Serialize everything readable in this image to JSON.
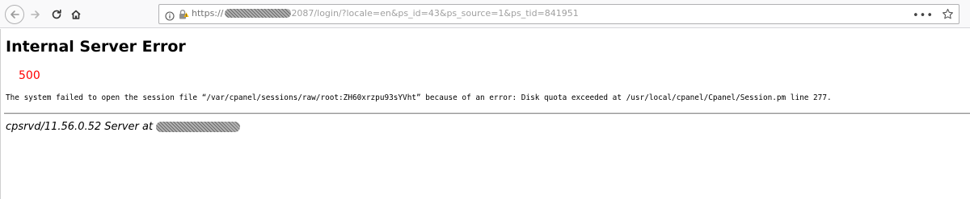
{
  "browser": {
    "url_scheme": "https://",
    "url_path": "2087/login/?locale=en&ps_id=43&ps_source=1&ps_tid=841951",
    "page_actions_label": "•••",
    "icons": {
      "back": "back-arrow-icon",
      "forward": "forward-arrow-icon",
      "reload": "reload-icon",
      "home": "home-icon",
      "info": "info-icon",
      "lock": "insecure-lock-icon",
      "star": "bookmark-star-icon"
    }
  },
  "page": {
    "title": "Internal Server Error",
    "code": "500",
    "message": "The system failed to open the session file “/var/cpanel/sessions/raw/root:ZH60xrzpu93sYVht” because of an error: Disk quota exceeded at /usr/local/cpanel/Cpanel/Session.pm line 277.",
    "signature": "cpsrvd/11.56.0.52 Server at"
  },
  "colors": {
    "error_code": "#ff0000",
    "text": "#000000",
    "url_text": "#737373",
    "toolbar_bg": "#f9f9fa"
  }
}
